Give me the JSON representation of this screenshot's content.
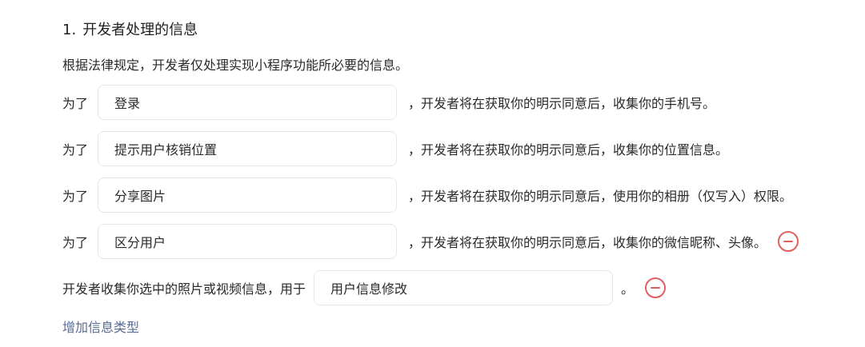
{
  "section": {
    "number": "1.",
    "title": "开发者处理的信息"
  },
  "intro": "根据法律规定，开发者仅处理实现小程序功能所必要的信息。",
  "rows": [
    {
      "prefix": "为了",
      "purpose": "登录",
      "suffix": "，开发者将在获取你的明示同意后，收集你的手机号。"
    },
    {
      "prefix": "为了",
      "purpose": "提示用户核销位置",
      "suffix": "，开发者将在获取你的明示同意后，收集你的位置信息。"
    },
    {
      "prefix": "为了",
      "purpose": "分享图片",
      "suffix": "，开发者将在获取你的明示同意后，使用你的相册（仅写入）权限。"
    },
    {
      "prefix": "为了",
      "purpose": "区分用户",
      "suffix": "，开发者将在获取你的明示同意后，收集你的微信昵称、头像。"
    }
  ],
  "media": {
    "label": "开发者收集你选中的照片或视频信息，用于",
    "purpose": "用户信息修改",
    "period": "。"
  },
  "add_link": "增加信息类型",
  "colors": {
    "link": "#576b95",
    "remove": "#e06060",
    "border": "#e6e6e6"
  }
}
